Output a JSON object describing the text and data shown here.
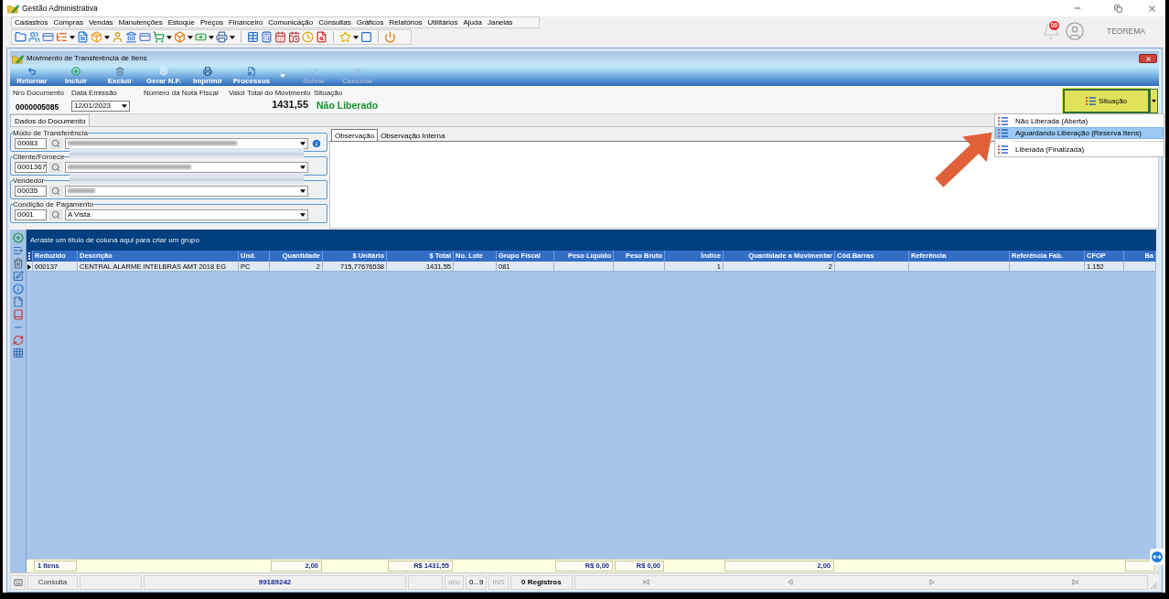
{
  "app": {
    "title": "Gestão Administrativa"
  },
  "menu": [
    "Cadastros",
    "Compras",
    "Vendas",
    "Manutenções",
    "Estoque",
    "Preços",
    "Financeiro",
    "Comunicação",
    "Consultas",
    "Gráficos",
    "Relatórios",
    "Utilitários",
    "Ajuda",
    "Janelas"
  ],
  "user": {
    "notifications": "00",
    "name": "TEOREMA"
  },
  "window": {
    "title": "Movimento de Transferência de Itens"
  },
  "actions": [
    {
      "label": "Retornar",
      "kind": "button",
      "disabled": false
    },
    {
      "label": "Incluir",
      "kind": "button",
      "disabled": false
    },
    {
      "label": "Excluir",
      "kind": "button",
      "disabled": false
    },
    {
      "label": "Gerar N.F.",
      "kind": "button",
      "disabled": false
    },
    {
      "label": "Imprimir",
      "kind": "button",
      "disabled": false
    },
    {
      "label": "Processos",
      "kind": "menu",
      "disabled": false
    },
    {
      "label": "Salvar",
      "kind": "button",
      "disabled": true
    },
    {
      "label": "Cancelar",
      "kind": "button",
      "disabled": true
    }
  ],
  "document": {
    "number_label": "Nro Documento",
    "number": "0000005085",
    "date_label": "Data Emissão",
    "date": "12/01/2023",
    "invoice_label": "Número da Nota Fiscal",
    "total_label": "Valor Total do Movimento",
    "total": "1431,55",
    "status_label": "Situação",
    "status": "Não Liberado"
  },
  "status_button": {
    "label": "Situação"
  },
  "status_menu": {
    "items": [
      {
        "label": "Não Liberada (Aberta)",
        "selected": false
      },
      {
        "label": "Aguardando Liberação (Reserva Itens)",
        "selected": true
      },
      {
        "label": "Liberada (Finalizada)",
        "selected": false
      }
    ]
  },
  "tabs": [
    {
      "label": "Dados do Documento",
      "selected": true
    }
  ],
  "fields": [
    {
      "label": "Modo de Transferência",
      "code": "00083",
      "info": true
    },
    {
      "label": "Cliente/Fornece",
      "code": "0001367",
      "info": false
    },
    {
      "label": "Vendedor",
      "code": "00035",
      "info": false
    },
    {
      "label": "Condição de Pagamento",
      "code": "0001",
      "value": "A Vista",
      "info": false
    }
  ],
  "notes": {
    "tabs": [
      {
        "label": "Observação",
        "selected": true
      },
      {
        "label": "Observação Interna",
        "selected": false
      }
    ]
  },
  "grid": {
    "group_hint": "Arraste um título de coluna aqui para criar um grupo",
    "columns": [
      "Reduzido",
      "Descrição",
      "Und.",
      "Quantidade",
      "$ Unitário",
      "$ Total",
      "No. Lote",
      "Grupo Fiscal",
      "Peso Líquido",
      "Peso Bruto",
      "Índice",
      "Quantidade a Movimentar",
      "Cód.Barras",
      "Referência",
      "Referência Fab.",
      "CFOP",
      "Ba"
    ],
    "rows": [
      {
        "selected": true,
        "cells": [
          "000137",
          "CENTRAL ALARME INTELBRAS AMT 2018 EG",
          "PC",
          "2",
          "715,77676538",
          "1431,55",
          null,
          "081",
          null,
          null,
          "1",
          "2",
          null,
          null,
          null,
          "1.152",
          null
        ]
      }
    ],
    "summary": [
      {
        "kind": "total",
        "value": "1 Itens"
      },
      {
        "kind": "none"
      },
      {
        "kind": "none"
      },
      {
        "kind": "total",
        "value": "2,00"
      },
      {
        "kind": "none"
      },
      {
        "kind": "total",
        "value": "R$ 1431,55"
      },
      {
        "kind": "none"
      },
      {
        "kind": "none"
      },
      {
        "kind": "total",
        "value": "R$ 0,00"
      },
      {
        "kind": "total",
        "value": "R$ 0,00"
      },
      {
        "kind": "none"
      },
      {
        "kind": "total",
        "value": "2,00"
      },
      {
        "kind": "none"
      },
      {
        "kind": "none"
      },
      {
        "kind": "none"
      },
      {
        "kind": "none"
      },
      {
        "kind": "total"
      }
    ]
  },
  "status_bar": {
    "mode": "Consulta",
    "code": "99189242",
    "indicators": [
      {
        "label": "abc",
        "on": false
      },
      {
        "label": "0...9",
        "on": true
      },
      {
        "label": "INS",
        "on": false
      }
    ],
    "records": "0 Registros"
  }
}
